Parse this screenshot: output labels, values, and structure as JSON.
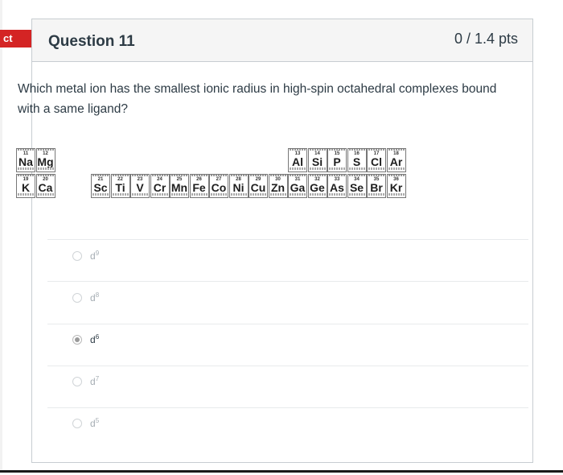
{
  "status_tag": "ct",
  "question": {
    "title": "Question 11",
    "points": "0 / 1.4 pts",
    "text": "Which metal ion has the smallest ionic radius in high-spin octahedral complexes bound with a same ligand?"
  },
  "periodic_table": {
    "period3": [
      {
        "num": "11",
        "sym": "Na"
      },
      {
        "num": "12",
        "sym": "Mg"
      },
      {
        "num": "13",
        "sym": "Al"
      },
      {
        "num": "14",
        "sym": "Si"
      },
      {
        "num": "15",
        "sym": "P"
      },
      {
        "num": "16",
        "sym": "S"
      },
      {
        "num": "17",
        "sym": "Cl"
      },
      {
        "num": "18",
        "sym": "Ar"
      }
    ],
    "period4": [
      {
        "num": "19",
        "sym": "K"
      },
      {
        "num": "20",
        "sym": "Ca"
      },
      {
        "num": "21",
        "sym": "Sc"
      },
      {
        "num": "22",
        "sym": "Ti"
      },
      {
        "num": "23",
        "sym": "V"
      },
      {
        "num": "24",
        "sym": "Cr"
      },
      {
        "num": "25",
        "sym": "Mn"
      },
      {
        "num": "26",
        "sym": "Fe"
      },
      {
        "num": "27",
        "sym": "Co"
      },
      {
        "num": "28",
        "sym": "Ni"
      },
      {
        "num": "29",
        "sym": "Cu"
      },
      {
        "num": "30",
        "sym": "Zn"
      },
      {
        "num": "31",
        "sym": "Ga"
      },
      {
        "num": "32",
        "sym": "Ge"
      },
      {
        "num": "33",
        "sym": "As"
      },
      {
        "num": "34",
        "sym": "Se"
      },
      {
        "num": "35",
        "sym": "Br"
      },
      {
        "num": "36",
        "sym": "Kr"
      }
    ]
  },
  "choices": [
    {
      "base": "d",
      "sup": "9",
      "selected": false
    },
    {
      "base": "d",
      "sup": "8",
      "selected": false
    },
    {
      "base": "d",
      "sup": "6",
      "selected": true
    },
    {
      "base": "d",
      "sup": "7",
      "selected": false
    },
    {
      "base": "d",
      "sup": "5",
      "selected": false
    }
  ]
}
